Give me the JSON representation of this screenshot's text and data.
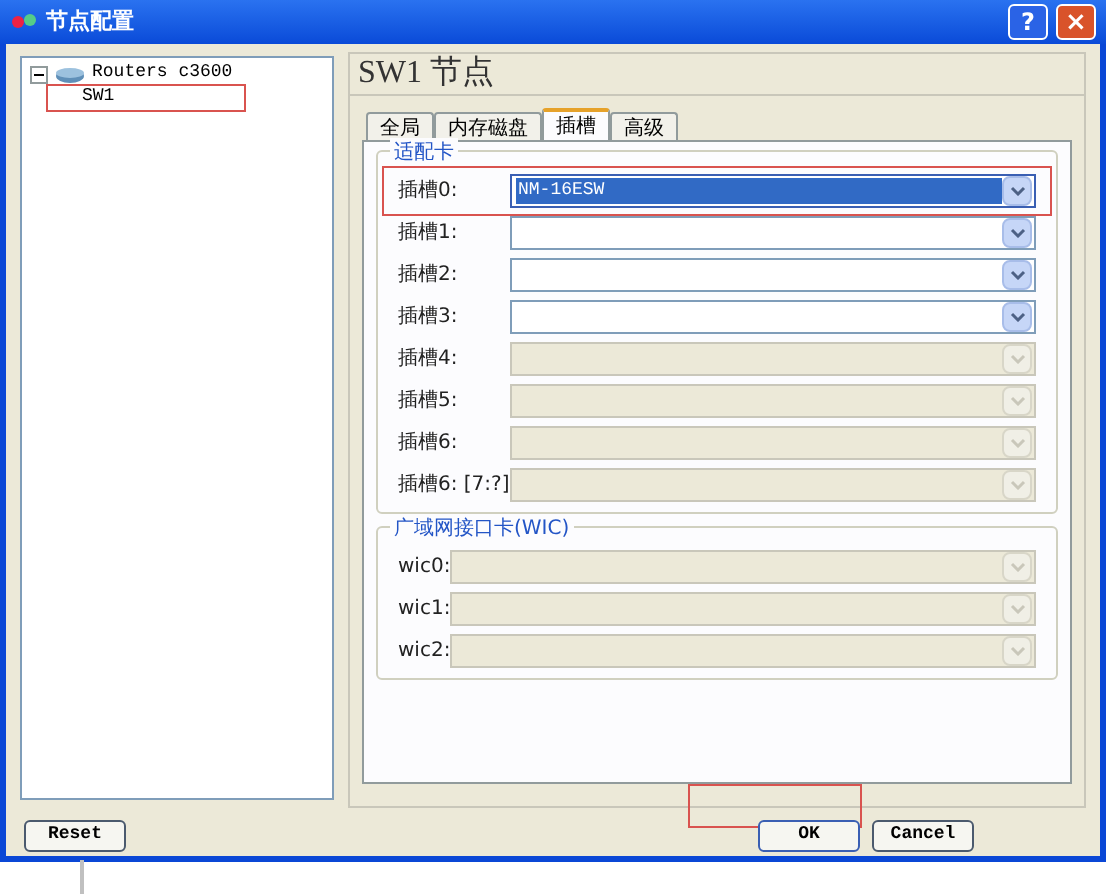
{
  "window": {
    "title": "节点配置",
    "help": "?",
    "close": "×"
  },
  "tree": {
    "root": {
      "label": "Routers c3600",
      "expanded": true,
      "children": [
        {
          "label": "SW1",
          "highlighted": true
        }
      ]
    }
  },
  "heading": "SW1 节点",
  "tabs": [
    {
      "label": "全局",
      "selected": false
    },
    {
      "label": "内存磁盘",
      "selected": false
    },
    {
      "label": "插槽",
      "selected": true
    },
    {
      "label": "高级",
      "selected": false
    }
  ],
  "adapters": {
    "legend": "适配卡",
    "slots": [
      {
        "label": "插槽0:",
        "value": "NM-16ESW",
        "disabled": false,
        "selected": true,
        "highlighted": true
      },
      {
        "label": "插槽1:",
        "disabled": false,
        "selected": false,
        "highlighted": false
      },
      {
        "label": "插槽2:",
        "disabled": false,
        "selected": false,
        "highlighted": false
      },
      {
        "label": "插槽3:",
        "disabled": false,
        "selected": false,
        "highlighted": false
      },
      {
        "label": "插槽4:",
        "disabled": true,
        "selected": false,
        "highlighted": false
      },
      {
        "label": "插槽5:",
        "disabled": true,
        "selected": false,
        "highlighted": false
      },
      {
        "label": "插槽6:",
        "disabled": true,
        "selected": false,
        "highlighted": false
      },
      {
        "label": "插槽6: [7:?]",
        "disabled": true,
        "selected": false,
        "highlighted": false
      }
    ]
  },
  "wic": {
    "legend": "广域网接口卡(WIC)",
    "slots": [
      {
        "label": "wic0:",
        "disabled": true
      },
      {
        "label": "wic1:",
        "disabled": true
      },
      {
        "label": "wic2:",
        "disabled": true
      }
    ]
  },
  "buttons": [
    {
      "kind": "reset",
      "label": "Reset",
      "highlighted": false
    },
    {
      "kind": "ok",
      "label": "OK",
      "highlighted": true
    },
    {
      "kind": "cancel",
      "label": "Cancel",
      "highlighted": false
    }
  ]
}
